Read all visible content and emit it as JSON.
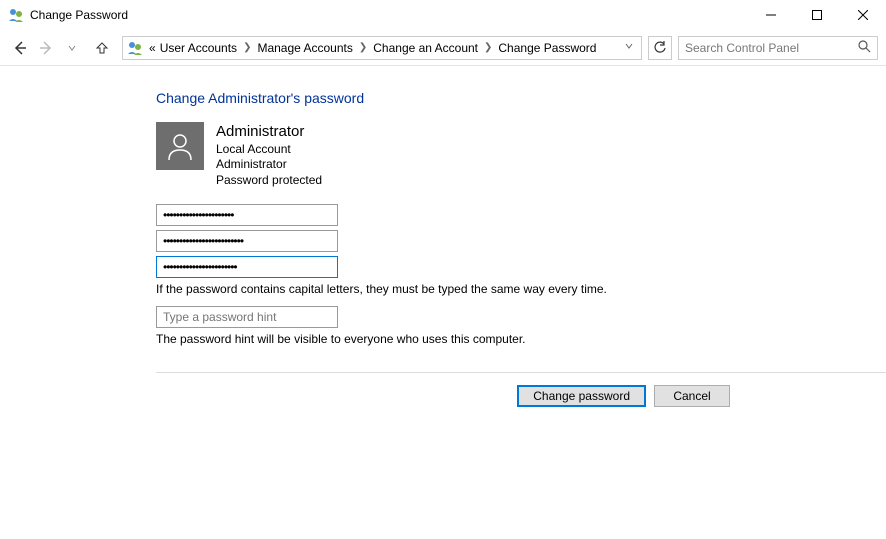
{
  "window": {
    "title": "Change Password"
  },
  "breadcrumb": {
    "prefix": "«",
    "items": [
      "User Accounts",
      "Manage Accounts",
      "Change an Account",
      "Change Password"
    ]
  },
  "search": {
    "placeholder": "Search Control Panel"
  },
  "heading": "Change Administrator's password",
  "account": {
    "name": "Administrator",
    "type": "Local Account",
    "role": "Administrator",
    "status": "Password protected"
  },
  "fields": {
    "current_value": "••••••••••••••••••••••",
    "new_value": "•••••••••••••••••••••••••",
    "confirm_value": "•••••••••••••••••••••••",
    "caps_note": "If the password contains capital letters, they must be typed the same way every time.",
    "hint_placeholder": "Type a password hint",
    "hint_note": "The password hint will be visible to everyone who uses this computer."
  },
  "buttons": {
    "primary": "Change password",
    "cancel": "Cancel"
  }
}
